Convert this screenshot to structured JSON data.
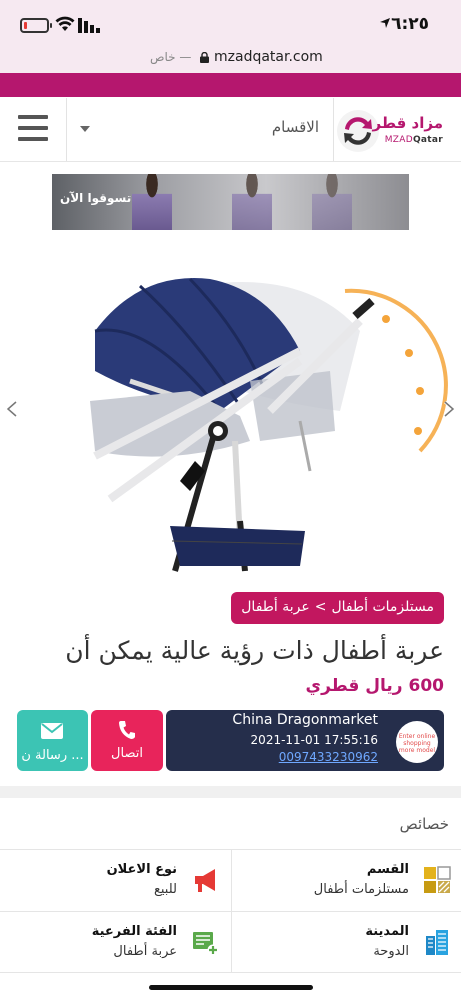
{
  "status_bar": {
    "time": "٦:٢٥",
    "battery_level": 0.15,
    "battery_color": "#e53935"
  },
  "url_bar": {
    "private_label": "خاص —",
    "url": "mzadqatar.com"
  },
  "colors": {
    "brand": "#b5176e",
    "breadcrumb": "#c2175f",
    "call": "#e8245b",
    "message": "#3cc4b4",
    "seller_card": "#252e4b"
  },
  "header": {
    "logo_ar": "مزاد قطر",
    "logo_en_prefix": "MZAD",
    "logo_en_suffix": "Qatar",
    "categories_label": "الاقسام",
    "menu_icon": "hamburger-icon"
  },
  "banner": {
    "text": "تسوقوا الآن"
  },
  "product": {
    "breadcrumb": {
      "parent": "مستلزمات أطفال",
      "separator": ">",
      "current": "عربة أطفال"
    },
    "title": "عربة أطفال ذات رؤية عالية يمكن أن",
    "price": "600 ريال قطري"
  },
  "seller": {
    "name": "China Dragonmarket",
    "datetime": "2021-11-01 17:55:16",
    "phone": "0097433230962",
    "logo_text": "Enter online shopping more model"
  },
  "actions": {
    "call_label": "اتصال",
    "message_label": "رسالة ن ..."
  },
  "properties": {
    "title": "خصائص",
    "items": [
      {
        "label": "القسم",
        "value": "مستلزمات أطفال",
        "icon": "category-icon"
      },
      {
        "label": "نوع الاعلان",
        "value": "للبيع",
        "icon": "megaphone-icon"
      },
      {
        "label": "المدينة",
        "value": "الدوحة",
        "icon": "city-icon"
      },
      {
        "label": "الفئة الفرعية",
        "value": "عربة أطفال",
        "icon": "subcategory-icon"
      }
    ]
  }
}
